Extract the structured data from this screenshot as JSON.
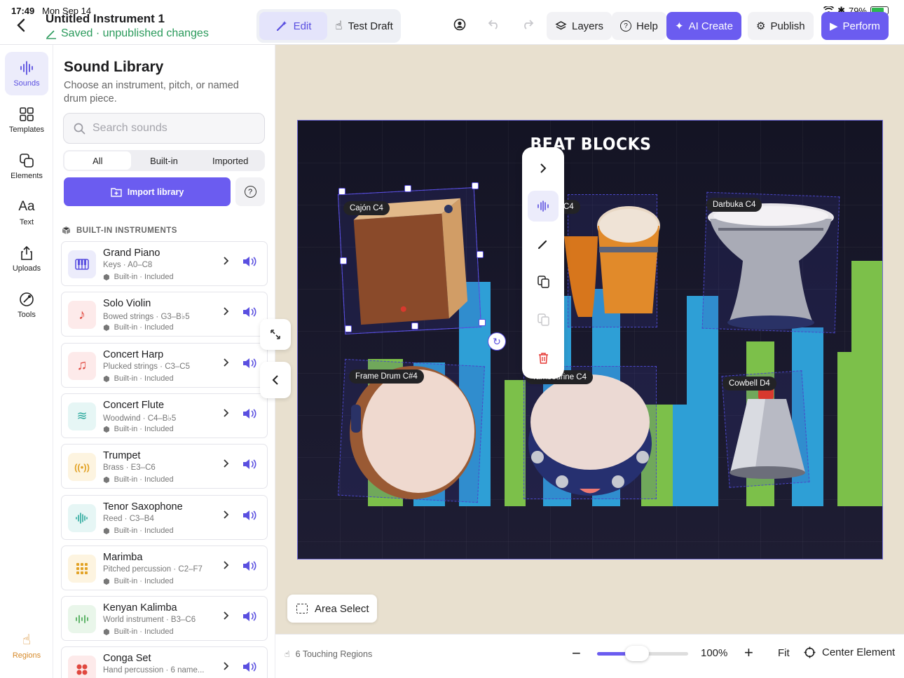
{
  "status_bar": {
    "time": "17:49",
    "date": "Mon Sep 14",
    "battery": "79%"
  },
  "header": {
    "title": "Untitled Instrument 1",
    "save_status": "Saved · unpublished changes",
    "modes": [
      {
        "label": "Edit",
        "active": true
      },
      {
        "label": "Test Draft",
        "active": false
      }
    ],
    "buttons": {
      "layers": "Layers",
      "help": "Help",
      "ai_create": "AI Create",
      "publish": "Publish",
      "perform": "Perform"
    }
  },
  "rail": {
    "items": [
      {
        "label": "Sounds",
        "icon": "waveform-icon",
        "active": true
      },
      {
        "label": "Templates",
        "icon": "grid-icon"
      },
      {
        "label": "Elements",
        "icon": "shapes-icon"
      },
      {
        "label": "Text",
        "icon": "text-icon",
        "glyph": "Aa"
      },
      {
        "label": "Uploads",
        "icon": "upload-icon"
      },
      {
        "label": "Tools",
        "icon": "tools-icon"
      }
    ],
    "bottom_item": {
      "label": "Regions",
      "icon": "hand-icon"
    }
  },
  "library": {
    "title": "Sound Library",
    "subtitle": "Choose an instrument, pitch, or named drum piece.",
    "search_placeholder": "Search sounds",
    "filters": [
      {
        "label": "All",
        "active": true
      },
      {
        "label": "Built-in"
      },
      {
        "label": "Imported"
      }
    ],
    "import_label": "Import library",
    "section_title": "BUILT-IN INSTRUMENTS",
    "badge": "Built-in · Included",
    "instruments": [
      {
        "name": "Grand Piano",
        "detail": "Keys · A0–C8",
        "color": "#ececfb",
        "fg": "#5a4fe0",
        "icon": "piano-icon"
      },
      {
        "name": "Solo Violin",
        "detail": "Bowed strings · G3–B♭5",
        "color": "#fdeaea",
        "fg": "#e0483f",
        "icon": "music-note-icon"
      },
      {
        "name": "Concert Harp",
        "detail": "Plucked strings · C3–C5",
        "color": "#fdeaea",
        "fg": "#e0483f",
        "icon": "music-notes-icon"
      },
      {
        "name": "Concert Flute",
        "detail": "Woodwind · C4–B♭5",
        "color": "#e6f6f5",
        "fg": "#2aa89c",
        "icon": "wind-icon"
      },
      {
        "name": "Trumpet",
        "detail": "Brass · E3–C6",
        "color": "#fdf4e0",
        "fg": "#e2a226",
        "icon": "broadcast-icon"
      },
      {
        "name": "Tenor Saxophone",
        "detail": "Reed · C3–B4",
        "color": "#e6f6f5",
        "fg": "#2aa89c",
        "icon": "waveform-icon"
      },
      {
        "name": "Marimba",
        "detail": "Pitched percussion · C2–F7",
        "color": "#fdf4e0",
        "fg": "#e2a226",
        "icon": "dots-grid-icon"
      },
      {
        "name": "Kenyan Kalimba",
        "detail": "World instrument · B3–C6",
        "color": "#e9f6ea",
        "fg": "#3da54a",
        "icon": "kalimba-icon"
      },
      {
        "name": "Conga Set",
        "detail": "Hand percussion · 6 name...",
        "color": "#fdeaea",
        "fg": "#e0483f",
        "icon": "drum-dots-icon"
      }
    ]
  },
  "canvas": {
    "title": "BEAT BLOCKS",
    "instruments": [
      {
        "label": "Cajón C4",
        "selected": true
      },
      {
        "label": "C4"
      },
      {
        "label": "Darbuka C4"
      },
      {
        "label": "Frame Drum C#4"
      },
      {
        "label": "Tambourine C4"
      },
      {
        "label": "Cowbell D4"
      }
    ],
    "bar_colors": [
      "#2e9fd6",
      "#7cc04a"
    ],
    "area_select_label": "Area Select"
  },
  "bottom": {
    "touching": "6 Touching Regions",
    "zoom": "100%",
    "zoom_fraction": 0.3,
    "fit": "Fit",
    "center": "Center Element"
  }
}
